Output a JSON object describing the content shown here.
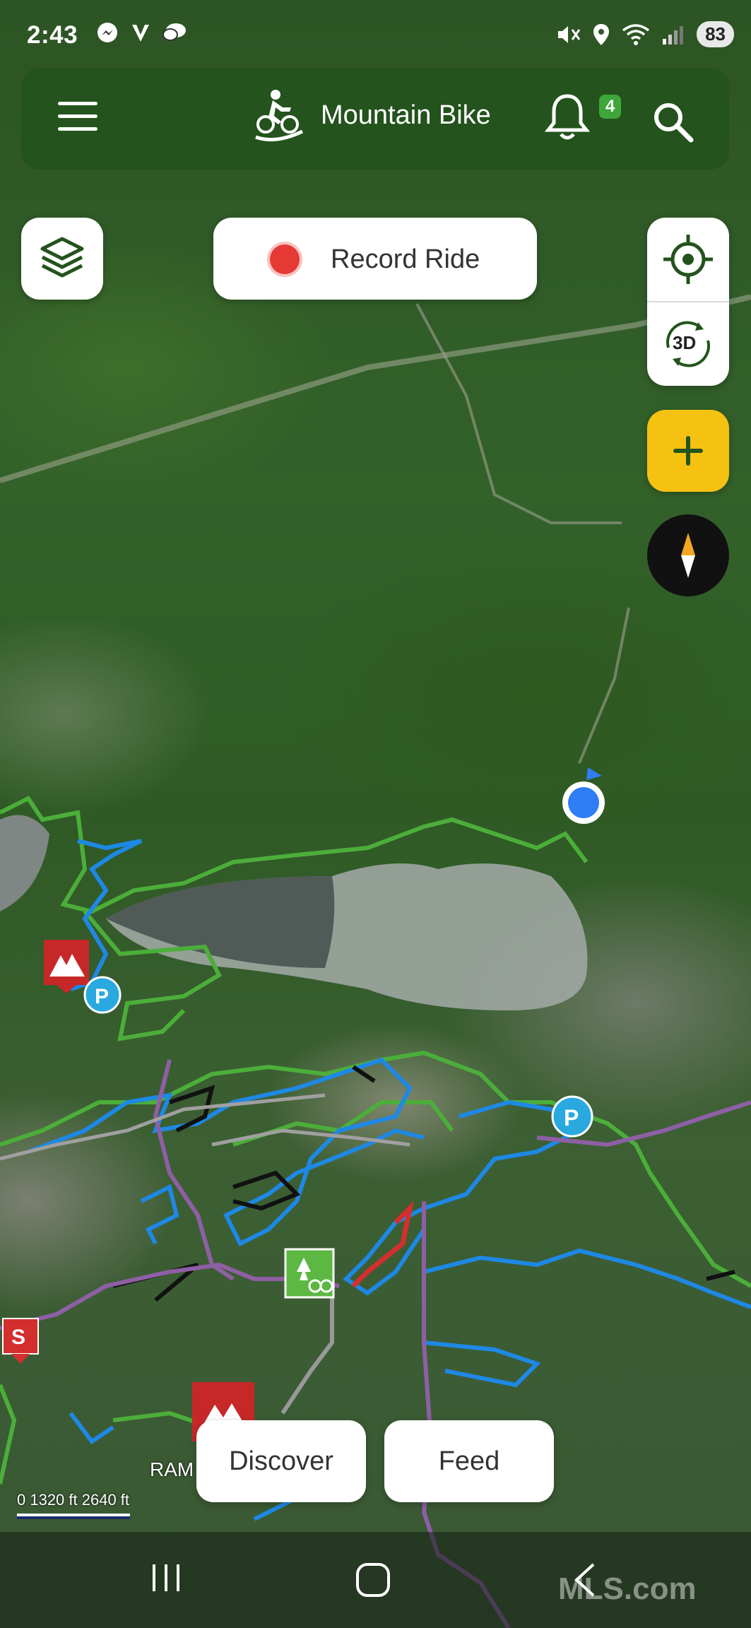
{
  "status_bar": {
    "time": "2:43",
    "battery": "83",
    "left_icons": [
      "messenger-icon",
      "v-icon",
      "chat-icon"
    ],
    "right_icons": [
      "mute-icon",
      "location-icon",
      "wifi-icon",
      "signal-icon"
    ]
  },
  "header": {
    "title": "Mountain Bike",
    "notification_count": "4",
    "bg_color": "#24531d"
  },
  "controls": {
    "record_label": "Record Ride",
    "threed_label": "3D",
    "add_color": "#f5c211"
  },
  "bottom": {
    "discover_label": "Discover",
    "feed_label": "Feed"
  },
  "map": {
    "scale_labels": "0    1320 ft  2640 ft",
    "place_label": "RAM",
    "marker_letter": "S",
    "parking_label": "P",
    "trail_colors": {
      "easy": "#4cae3a",
      "intermediate": "#1e88e5",
      "difficult": "#111111",
      "extreme": "#d32f2f",
      "road": "#8e5fa5"
    }
  },
  "nav": {
    "watermark": "MLS.com"
  }
}
